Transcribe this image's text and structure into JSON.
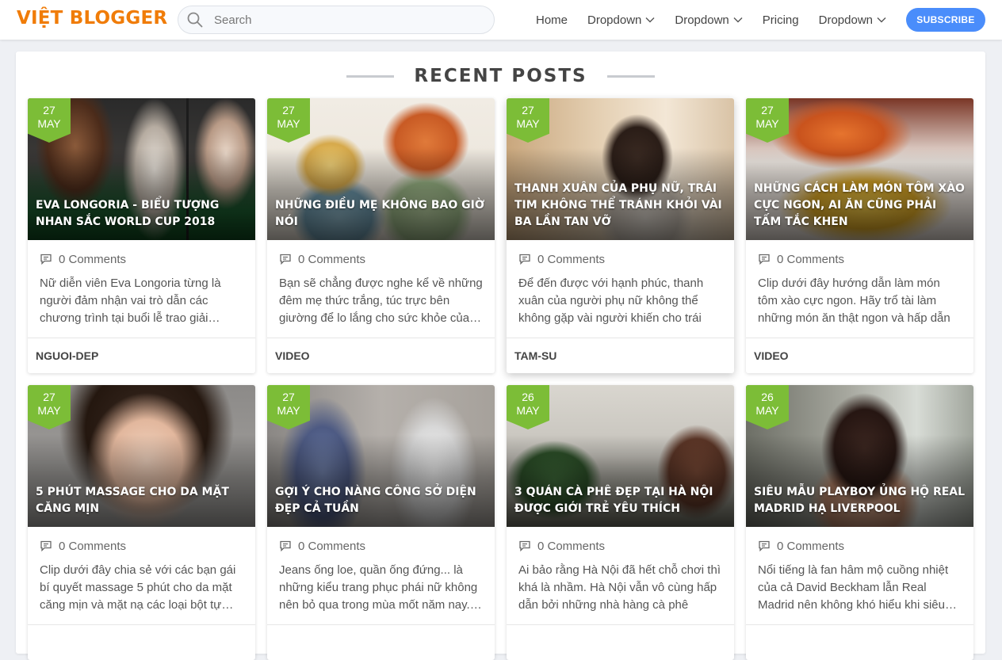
{
  "header": {
    "logo": "VIỆT BLOGGER",
    "search_placeholder": "Search",
    "nav": [
      {
        "label": "Home",
        "dropdown": false
      },
      {
        "label": "Dropdown",
        "dropdown": true
      },
      {
        "label": "Dropdown",
        "dropdown": true
      },
      {
        "label": "Pricing",
        "dropdown": false
      },
      {
        "label": "Dropdown",
        "dropdown": true
      }
    ],
    "subscribe_label": "SUBSCRIBE"
  },
  "section_title": "RECENT POSTS",
  "colors": {
    "accent": "#4a8dfb",
    "brand": "#f07c08",
    "badge": "#7cbd37"
  },
  "posts": [
    {
      "day": "27",
      "month": "MAY",
      "title": "EVA LONGORIA - BIỂU TƯỢNG NHAN SẮC WORLD CUP 2018",
      "comments": "0 Comments",
      "excerpt": "Nữ diễn viên Eva Longoria từng là người đảm nhận vai trò dẫn các chương trình tại buổi lễ trao giải…",
      "category": "NGUOI-DEP"
    },
    {
      "day": "27",
      "month": "MAY",
      "title": "NHỮNG ĐIỀU MẸ KHÔNG BAO GIỜ NÓI",
      "comments": "0 Comments",
      "excerpt": "Bạn sẽ chẳng được nghe kể về những đêm mẹ thức trắng, túc trực bên giường để lo lắng cho sức khỏe của…",
      "category": "VIDEO"
    },
    {
      "day": "27",
      "month": "MAY",
      "title": "THANH XUÂN CỦA PHỤ NỮ, TRÁI TIM KHÔNG THỂ TRÁNH KHỎI VÀI BA LẦN TAN VỠ",
      "comments": "0 Comments",
      "excerpt": "Để đến được với hạnh phúc, thanh xuân của người phụ nữ không thể không gặp vài người khiến cho trái ti…",
      "category": "TAM-SU"
    },
    {
      "day": "27",
      "month": "MAY",
      "title": "NHỮNG CÁCH LÀM MÓN TÔM XÀO CỰC NGON, AI ĂN CŨNG PHẢI TẤM TẮC KHEN",
      "comments": "0 Comments",
      "excerpt": "Clip dưới đây hướng dẫn làm món tôm xào cực ngon. Hãy trổ tài làm những món ăn thật ngon và hấp dẫn từ tôm…",
      "category": "VIDEO"
    },
    {
      "day": "27",
      "month": "MAY",
      "title": "5 PHÚT MASSAGE CHO DA MẶT CĂNG MỊN",
      "comments": "0 Comments",
      "excerpt": "Clip dưới đây chia sẻ với các bạn gái bí quyết massage 5 phút cho da mặt căng mịn và mặt nạ các loại bột tự…",
      "category": ""
    },
    {
      "day": "27",
      "month": "MAY",
      "title": "GỢI Ý CHO NÀNG CÔNG SỞ DIỆN ĐẸP CẢ TUẦN",
      "comments": "0 Comments",
      "excerpt": "Jeans ống loe, quần ống đứng... là những kiểu trang phục phái nữ không nên bỏ qua trong mùa mốt năm nay.…",
      "category": ""
    },
    {
      "day": "26",
      "month": "MAY",
      "title": "3 QUÁN CÀ PHÊ ĐẸP TẠI HÀ NỘI ĐƯỢC GIỚI TRẺ YÊU THÍCH",
      "comments": "0 Comments",
      "excerpt": "Ai bảo rằng Hà Nội đã hết chỗ chơi thì khá là nhầm. Hà Nội vẫn vô cùng hấp dẫn bởi những nhà hàng cà phê xinh…",
      "category": ""
    },
    {
      "day": "26",
      "month": "MAY",
      "title": "SIÊU MẪU PLAYBOY ỦNG HỘ REAL MADRID HẠ LIVERPOOL",
      "comments": "0 Comments",
      "excerpt": "Nổi tiếng là fan hâm mộ cuồng nhiệt của cả David Beckham lẫn Real Madrid nên không khó hiểu khi siêu…",
      "category": ""
    }
  ]
}
